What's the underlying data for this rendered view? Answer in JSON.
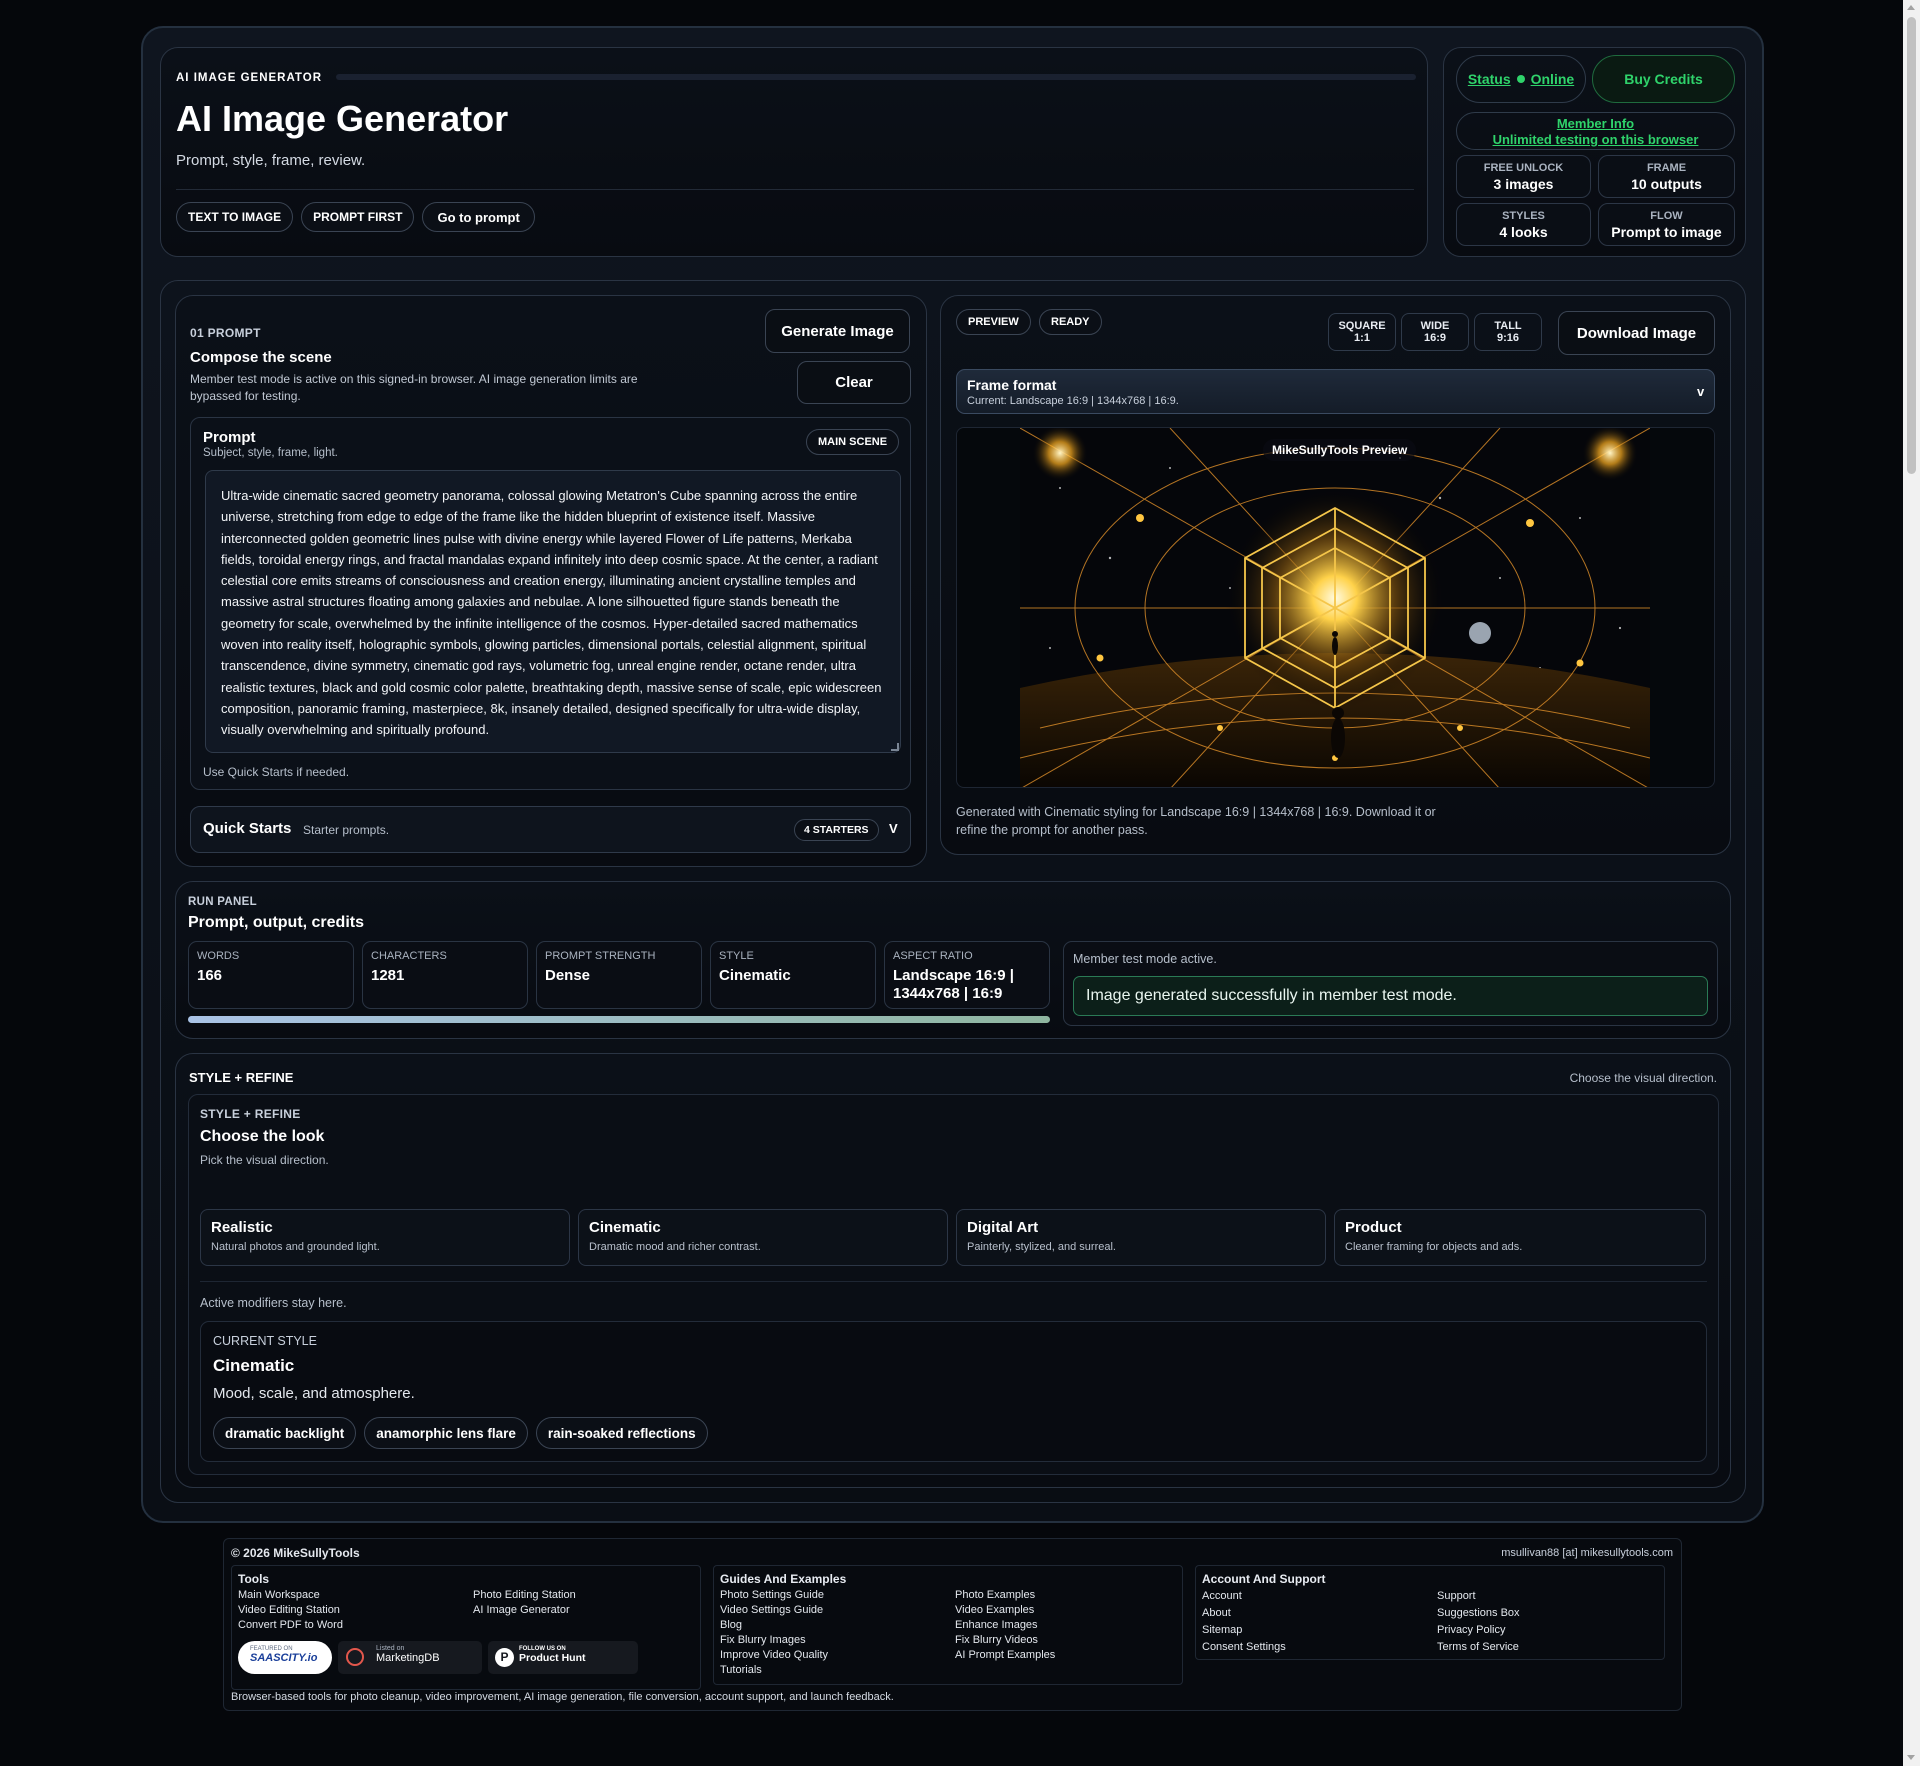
{
  "header": {
    "eyebrow": "AI IMAGE GENERATOR",
    "title": "AI Image Generator",
    "subtitle": "Prompt, style, frame, review.",
    "chips": [
      "TEXT TO IMAGE",
      "PROMPT FIRST"
    ],
    "goto_label": "Go to prompt"
  },
  "status_panel": {
    "status_label": "Status",
    "status_value": "Online",
    "buy_label": "Buy Credits",
    "member_info_title": "Member Info",
    "member_info_sub": "Unlimited testing on this browser",
    "stats": [
      {
        "key": "FREE UNLOCK",
        "value": "3 images"
      },
      {
        "key": "FRAME",
        "value": "10 outputs"
      },
      {
        "key": "STYLES",
        "value": "4 looks"
      },
      {
        "key": "FLOW",
        "value": "Prompt to image"
      }
    ]
  },
  "prompt_section": {
    "step": "01 PROMPT",
    "title": "Compose the scene",
    "note": "Member test mode is active on this signed-in browser. AI image generation limits are bypassed for testing.",
    "generate_label": "Generate Image",
    "clear_label": "Clear",
    "box_title": "Prompt",
    "box_sub": "Subject, style, frame, light.",
    "badge": "MAIN SCENE",
    "prompt_text": "Ultra-wide cinematic sacred geometry panorama, colossal glowing Metatron's Cube spanning across the entire universe, stretching from edge to edge of the frame like the hidden blueprint of existence itself. Massive interconnected golden geometric lines pulse with divine energy while layered Flower of Life patterns, Merkaba fields, toroidal energy rings, and fractal mandalas expand infinitely into deep cosmic space. At the center, a radiant celestial core emits streams of consciousness and creation energy, illuminating ancient crystalline temples and massive astral structures floating among galaxies and nebulae. A lone silhouetted figure stands beneath the geometry for scale, overwhelmed by the infinite intelligence of the cosmos. Hyper-detailed sacred mathematics woven into reality itself, holographic symbols, glowing particles, dimensional portals, celestial alignment, spiritual transcendence, divine symmetry, cinematic god rays, volumetric fog, unreal engine render, octane render, ultra realistic textures, black and gold cosmic color palette, breathtaking depth, massive sense of scale, epic widescreen composition, panoramic framing, masterpiece, 8k, insanely detailed, designed specifically for ultra-wide display, visually overwhelming and spiritually profound.",
    "hint": "Use Quick Starts if needed.",
    "quick_title": "Quick Starts",
    "quick_sub": "Starter prompts.",
    "quick_badge": "4 STARTERS",
    "quick_chevron": "V"
  },
  "preview_section": {
    "chips": [
      "PREVIEW",
      "READY"
    ],
    "ratios": [
      {
        "line1": "SQUARE",
        "line2": "1:1"
      },
      {
        "line1": "WIDE",
        "line2": "16:9"
      },
      {
        "line1": "TALL",
        "line2": "9:16"
      }
    ],
    "download_label": "Download Image",
    "frame_title": "Frame format",
    "frame_current": "Current: Landscape 16:9 | 1344x768 | 16:9.",
    "frame_chevron": "v",
    "watermark": "MikeSullyTools Preview",
    "caption": "Generated with Cinematic styling for Landscape 16:9 | 1344x768 | 16:9. Download it or refine the prompt for another pass."
  },
  "run_panel": {
    "eyebrow": "RUN PANEL",
    "title": "Prompt, output, credits",
    "metrics": [
      {
        "key": "WORDS",
        "value": "166"
      },
      {
        "key": "CHARACTERS",
        "value": "1281"
      },
      {
        "key": "PROMPT STRENGTH",
        "value": "Dense"
      },
      {
        "key": "STYLE",
        "value": "Cinematic"
      },
      {
        "key": "ASPECT RATIO",
        "value": "Landscape 16:9 | 1344x768 | 16:9"
      }
    ],
    "progress": 1.0,
    "mode_note": "Member test mode active.",
    "success": "Image generated successfully in member test mode."
  },
  "style_section": {
    "heading": "STYLE + REFINE",
    "heading_right": "Choose the visual direction.",
    "inner_eyebrow": "STYLE + REFINE",
    "inner_title": "Choose the look",
    "inner_sub": "Pick the visual direction.",
    "cards": [
      {
        "title": "Realistic",
        "desc": "Natural photos and grounded light."
      },
      {
        "title": "Cinematic",
        "desc": "Dramatic mood and richer contrast."
      },
      {
        "title": "Digital Art",
        "desc": "Painterly, stylized, and surreal."
      },
      {
        "title": "Product",
        "desc": "Cleaner framing for objects and ads."
      }
    ],
    "modifiers_note": "Active modifiers stay here.",
    "current_label": "CURRENT STYLE",
    "current_name": "Cinematic",
    "current_desc": "Mood, scale, and atmosphere.",
    "tags": [
      "dramatic backlight",
      "anamorphic lens flare",
      "rain-soaked reflections"
    ]
  },
  "footer": {
    "copyright": "© 2026 MikeSullyTools",
    "email": "msullivan88 [at] mikesullytools.com",
    "tools_title": "Tools",
    "tools_col1": [
      "Main Workspace",
      "Video Editing Station",
      "Convert PDF to Word"
    ],
    "tools_col2": [
      "Photo Editing Station",
      "AI Image Generator"
    ],
    "badges": [
      {
        "top": "FEATURED ON",
        "name": "SAASCITY.io"
      },
      {
        "top": "Listed on",
        "name": "MarketingDB"
      },
      {
        "top": "FOLLOW US ON",
        "name": "Product Hunt"
      }
    ],
    "guides_title": "Guides And Examples",
    "guides_col1": [
      "Photo Settings Guide",
      "Video Settings Guide",
      "Blog",
      "Fix Blurry Images",
      "Improve Video Quality",
      "Tutorials"
    ],
    "guides_col2": [
      "Photo Examples",
      "Video Examples",
      "Enhance Images",
      "Fix Blurry Videos",
      "AI Prompt Examples"
    ],
    "account_title": "Account And Support",
    "account_col1": [
      "Account",
      "About",
      "Sitemap",
      "Consent Settings"
    ],
    "account_col2": [
      "Support",
      "Suggestions Box",
      "Privacy Policy",
      "Terms of Service"
    ],
    "tagline": "Browser-based tools for photo cleanup, video improvement, AI image generation, file conversion, account support, and launch feedback."
  },
  "colors": {
    "accent_green": "#2fd36b",
    "background": "#05070b",
    "panel": "#0b1018"
  }
}
